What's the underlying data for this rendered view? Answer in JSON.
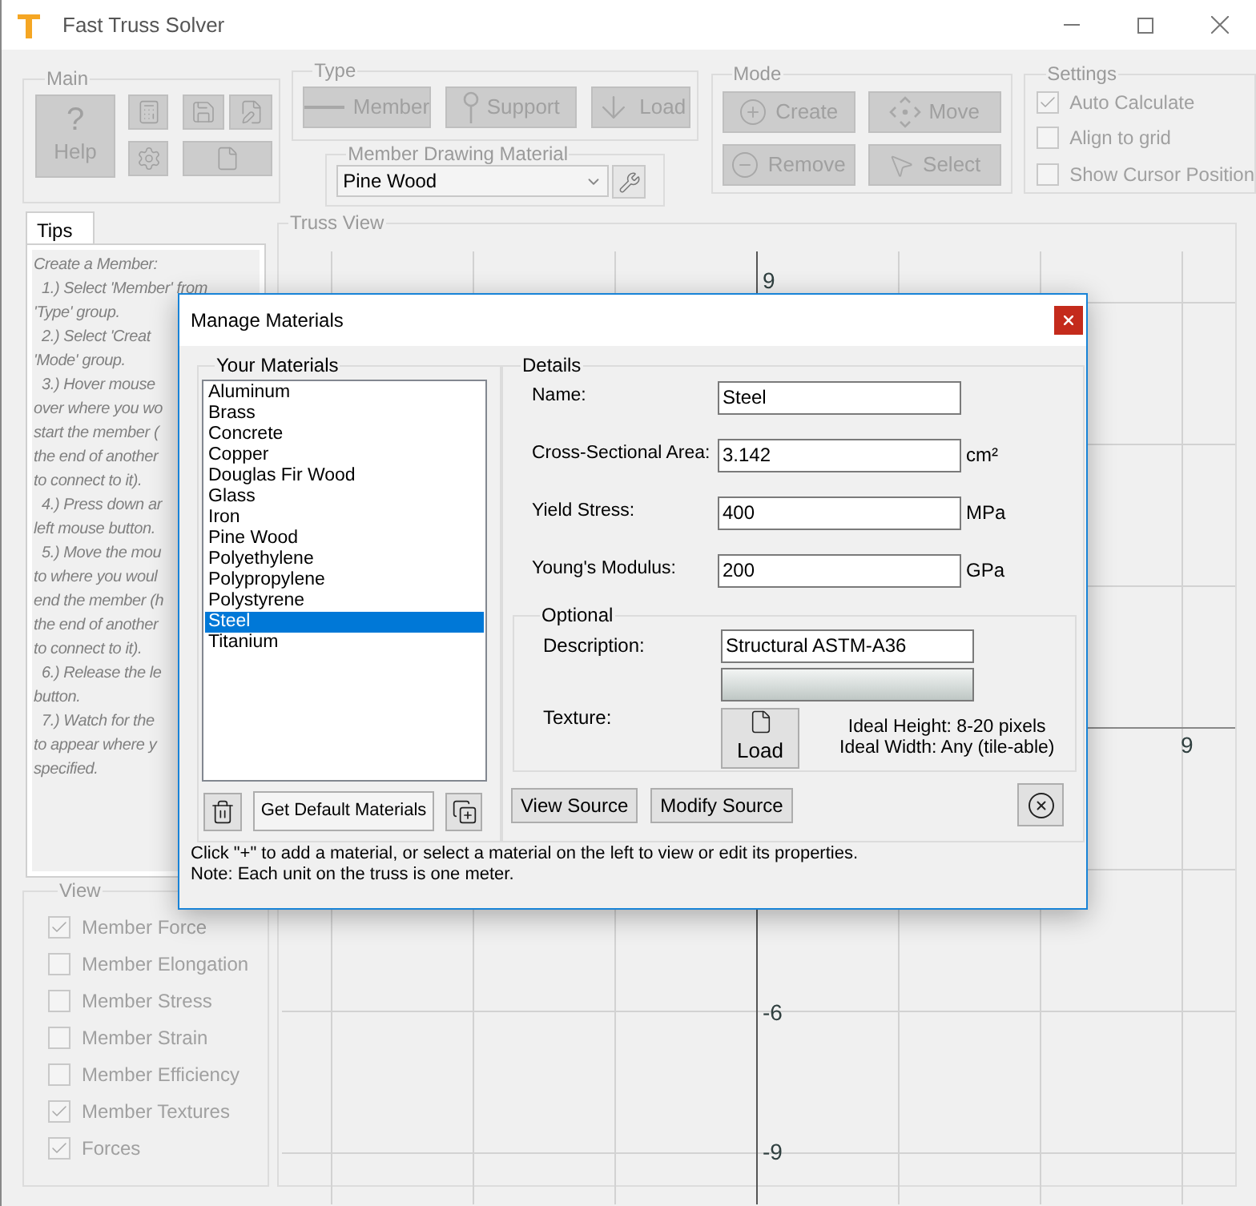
{
  "window": {
    "title": "Fast Truss Solver",
    "disabled": true
  },
  "main_group": {
    "label": "Main",
    "help": {
      "glyph": "?",
      "label": "Help"
    }
  },
  "type_group": {
    "label": "Type",
    "buttons": [
      {
        "kind": "member",
        "label": "Member"
      },
      {
        "kind": "support",
        "label": "Support"
      },
      {
        "kind": "load",
        "label": "Load"
      }
    ]
  },
  "material_group": {
    "label": "Member Drawing Material",
    "value": "Pine Wood"
  },
  "mode_group": {
    "label": "Mode",
    "buttons": [
      {
        "kind": "create",
        "label": "Create"
      },
      {
        "kind": "move",
        "label": "Move"
      },
      {
        "kind": "remove",
        "label": "Remove"
      },
      {
        "kind": "select",
        "label": "Select"
      }
    ]
  },
  "settings": {
    "label": "Settings",
    "options": [
      {
        "label": "Auto Calculate",
        "checked": true
      },
      {
        "label": "Align to grid",
        "checked": false
      },
      {
        "label": "Show Cursor Position",
        "checked": false
      }
    ]
  },
  "tips": {
    "tab": "Tips",
    "lines": [
      {
        "text": "Create a Member:",
        "indent": false
      },
      {
        "text": "1.) Select 'Member' from",
        "indent": true
      },
      {
        "text": "'Type' group.",
        "indent": false
      },
      {
        "text": "2.) Select 'Creat",
        "indent": true
      },
      {
        "text": "'Mode' group.",
        "indent": false
      },
      {
        "text": "3.) Hover mouse",
        "indent": true
      },
      {
        "text": "over where you wo",
        "indent": false
      },
      {
        "text": "start the member (",
        "indent": false
      },
      {
        "text": "the end of another",
        "indent": false
      },
      {
        "text": "to connect to it).",
        "indent": false
      },
      {
        "text": "4.) Press down ar",
        "indent": true
      },
      {
        "text": "left mouse button.",
        "indent": false
      },
      {
        "text": "5.) Move the mou",
        "indent": true
      },
      {
        "text": "to where you woul",
        "indent": false
      },
      {
        "text": "end the member (h",
        "indent": false
      },
      {
        "text": "the end of another",
        "indent": false
      },
      {
        "text": "to connect to it).",
        "indent": false
      },
      {
        "text": "6.) Release the le",
        "indent": true
      },
      {
        "text": "button.",
        "indent": false
      },
      {
        "text": "7.) Watch for the",
        "indent": true
      },
      {
        "text": "to appear where y",
        "indent": false
      },
      {
        "text": "specified.",
        "indent": false
      }
    ]
  },
  "view_group": {
    "label": "View",
    "options": [
      {
        "label": "Member Force",
        "checked": true
      },
      {
        "label": "Member Elongation",
        "checked": false
      },
      {
        "label": "Member Stress",
        "checked": false
      },
      {
        "label": "Member Strain",
        "checked": false
      },
      {
        "label": "Member Efficiency",
        "checked": false
      },
      {
        "label": "Member Textures",
        "checked": true
      },
      {
        "label": "Forces",
        "checked": true
      }
    ]
  },
  "truss_view": {
    "label": "Truss View",
    "y_labels": [
      "9",
      "-6",
      "-9"
    ],
    "x_labels": [
      "9"
    ]
  },
  "dialog": {
    "title": "Manage Materials",
    "materials_group": {
      "label": "Your Materials",
      "items": [
        {
          "name": "Aluminum",
          "selected": false
        },
        {
          "name": "Brass",
          "selected": false
        },
        {
          "name": "Concrete",
          "selected": false
        },
        {
          "name": "Copper",
          "selected": false
        },
        {
          "name": "Douglas Fir Wood",
          "selected": false
        },
        {
          "name": "Glass",
          "selected": false
        },
        {
          "name": "Iron",
          "selected": false
        },
        {
          "name": "Pine Wood",
          "selected": false
        },
        {
          "name": "Polyethylene",
          "selected": false
        },
        {
          "name": "Polypropylene",
          "selected": false
        },
        {
          "name": "Polystyrene",
          "selected": false
        },
        {
          "name": "Steel",
          "selected": true
        },
        {
          "name": "Titanium",
          "selected": false
        }
      ],
      "default_button": "Get Default Materials"
    },
    "details": {
      "label": "Details",
      "fields": [
        {
          "label": "Name:",
          "value": "Steel"
        },
        {
          "label": "Cross-Sectional Area:",
          "value": "3.142",
          "unit": "cm²"
        },
        {
          "label": "Yield Stress:",
          "value": "400",
          "unit": "MPa"
        },
        {
          "label": "Young's Modulus:",
          "value": "200",
          "unit": "GPa"
        }
      ],
      "optional": {
        "label": "Optional",
        "description_label": "Description:",
        "description": "Structural ASTM-A36",
        "texture_label": "Texture:",
        "load_button": "Load",
        "hints": [
          "Ideal Height: 8-20 pixels",
          "Ideal Width: Any (tile-able)"
        ]
      },
      "buttons": [
        "View Source",
        "Modify Source"
      ]
    },
    "footer": [
      "Click \"+\" to add a material, or select a material on the left to view or edit its properties.",
      "Note: Each unit on the truss is one meter."
    ]
  }
}
